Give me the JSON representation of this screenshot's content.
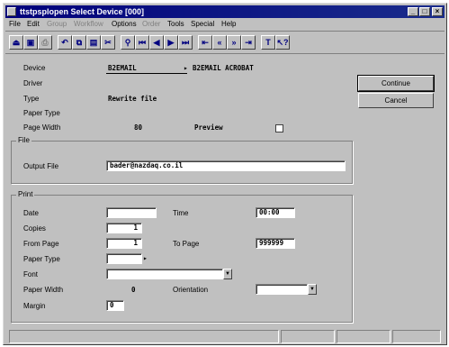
{
  "window": {
    "title": "ttstpsplopen   Select Device [000]"
  },
  "menu": [
    {
      "label": "File",
      "enabled": true
    },
    {
      "label": "Edit",
      "enabled": true
    },
    {
      "label": "Group",
      "enabled": false
    },
    {
      "label": "Workflow",
      "enabled": false
    },
    {
      "label": "Options",
      "enabled": true
    },
    {
      "label": "Order",
      "enabled": false
    },
    {
      "label": "Tools",
      "enabled": true
    },
    {
      "label": "Special",
      "enabled": true
    },
    {
      "label": "Help",
      "enabled": true
    }
  ],
  "toolbar_icons": [
    "exit-icon",
    "save-icon",
    "print-icon",
    "undo-icon",
    "copy-icon",
    "paste-icon",
    "delete-icon",
    "find-icon",
    "first-record-icon",
    "previous-record-icon",
    "next-record-icon",
    "last-record-icon",
    "first-page-icon",
    "previous-page-icon",
    "next-page-icon",
    "last-page-icon",
    "text-icon",
    "help-pointer-icon"
  ],
  "form": {
    "device_label": "Device",
    "device_value": "B2EMAIL",
    "device_desc": "B2EMAIL ACROBAT",
    "driver_label": "Driver",
    "type_label": "Type",
    "type_value": "Rewrite file",
    "paper_type_label": "Paper Type",
    "page_width_label": "Page Width",
    "page_width_value": "80",
    "preview_label": "Preview"
  },
  "file_group": {
    "title": "File",
    "output_file_label": "Output File",
    "output_file_value": "bader@nazdaq.co.il"
  },
  "print_group": {
    "title": "Print",
    "date_label": "Date",
    "date_value": "",
    "time_label": "Time",
    "time_value": "00:00",
    "copies_label": "Copies",
    "copies_value": "1",
    "from_page_label": "From Page",
    "from_page_value": "1",
    "to_page_label": "To Page",
    "to_page_value": "999999",
    "paper_type_label": "Paper Type",
    "font_label": "Font",
    "paper_width_label": "Paper Width",
    "paper_width_value": "0",
    "orientation_label": "Orientation",
    "margin_label": "Margin",
    "margin_value": "0"
  },
  "buttons": {
    "continue": "Continue",
    "cancel": "Cancel"
  },
  "colors": {
    "titlebar": "#00007b",
    "face": "#c0c0c0"
  }
}
